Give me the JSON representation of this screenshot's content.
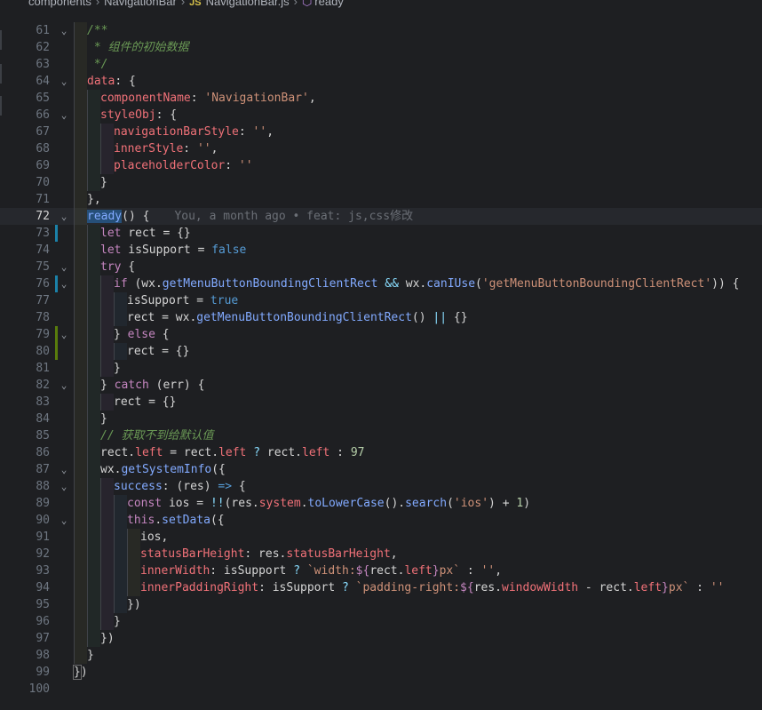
{
  "breadcrumb": {
    "folder": "components",
    "subfolder": "NavigationBar",
    "file_badge": "JS",
    "file": "NavigationBar.js",
    "symbol": "ready"
  },
  "colors": {
    "background": "#1e1f22",
    "keyword": "#c586c0",
    "string": "#ce9178",
    "property": "#f07178",
    "function": "#82aaff",
    "comment": "#6a9955",
    "modified_gutter": "#1b81a8",
    "added_gutter": "#587c0c"
  },
  "blame_line": 72,
  "blame": "You, a month ago • feat: js,css修改",
  "lines": [
    {
      "n": 61,
      "fold": true,
      "indent": 1,
      "tokens": [
        [
          "cm",
          "/**"
        ]
      ]
    },
    {
      "n": 62,
      "indent": 1,
      "tokens": [
        [
          "cm",
          " * 组件的初始数据"
        ]
      ]
    },
    {
      "n": 63,
      "indent": 1,
      "tokens": [
        [
          "cm",
          " */"
        ]
      ]
    },
    {
      "n": 64,
      "fold": true,
      "indent": 1,
      "tokens": [
        [
          "pr",
          "data"
        ],
        [
          "pl",
          ": {"
        ]
      ]
    },
    {
      "n": 65,
      "indent": 2,
      "tokens": [
        [
          "pr",
          "componentName"
        ],
        [
          "pl",
          ": "
        ],
        [
          "st",
          "'NavigationBar'"
        ],
        [
          "pl",
          ","
        ]
      ]
    },
    {
      "n": 66,
      "fold": true,
      "indent": 2,
      "tokens": [
        [
          "pr",
          "styleObj"
        ],
        [
          "pl",
          ": {"
        ]
      ]
    },
    {
      "n": 67,
      "indent": 3,
      "tokens": [
        [
          "pr",
          "navigationBarStyle"
        ],
        [
          "pl",
          ": "
        ],
        [
          "st",
          "''"
        ],
        [
          "pl",
          ","
        ]
      ]
    },
    {
      "n": 68,
      "indent": 3,
      "tokens": [
        [
          "pr",
          "innerStyle"
        ],
        [
          "pl",
          ": "
        ],
        [
          "st",
          "''"
        ],
        [
          "pl",
          ","
        ]
      ]
    },
    {
      "n": 69,
      "indent": 3,
      "tokens": [
        [
          "pr",
          "placeholderColor"
        ],
        [
          "pl",
          ": "
        ],
        [
          "st",
          "''"
        ]
      ]
    },
    {
      "n": 70,
      "indent": 2,
      "tokens": [
        [
          "pl",
          "}"
        ]
      ]
    },
    {
      "n": 71,
      "indent": 1,
      "tokens": [
        [
          "pl",
          "},"
        ]
      ]
    },
    {
      "n": 72,
      "fold": true,
      "current": true,
      "indent": 1,
      "tokens": [
        [
          "hl",
          "ready"
        ],
        [
          "pl",
          "() {"
        ]
      ]
    },
    {
      "n": 73,
      "mark": "mod",
      "indent": 2,
      "tokens": [
        [
          "kw",
          "let"
        ],
        [
          "pl",
          " rect = {}"
        ]
      ]
    },
    {
      "n": 74,
      "indent": 2,
      "tokens": [
        [
          "kw",
          "let"
        ],
        [
          "pl",
          " isSupport = "
        ],
        [
          "bl",
          "false"
        ]
      ]
    },
    {
      "n": 75,
      "fold": true,
      "indent": 2,
      "tokens": [
        [
          "kw",
          "try"
        ],
        [
          "pl",
          " {"
        ]
      ]
    },
    {
      "n": 76,
      "fold": true,
      "mark": "mod",
      "indent": 3,
      "tokens": [
        [
          "kw",
          "if"
        ],
        [
          "pl",
          " (wx."
        ],
        [
          "fn",
          "getMenuButtonBoundingClientRect"
        ],
        [
          "pl",
          " "
        ],
        [
          "op",
          "&&"
        ],
        [
          "pl",
          " wx."
        ],
        [
          "fn",
          "canIUse"
        ],
        [
          "pl",
          "("
        ],
        [
          "st",
          "'getMenuButtonBoundingClientRect'"
        ],
        [
          "pl",
          ")) {"
        ]
      ]
    },
    {
      "n": 77,
      "indent": 4,
      "tokens": [
        [
          "pl",
          "isSupport = "
        ],
        [
          "bl",
          "true"
        ]
      ]
    },
    {
      "n": 78,
      "indent": 4,
      "tokens": [
        [
          "pl",
          "rect = wx."
        ],
        [
          "fn",
          "getMenuButtonBoundingClientRect"
        ],
        [
          "pl",
          "() "
        ],
        [
          "op",
          "||"
        ],
        [
          "pl",
          " {}"
        ]
      ]
    },
    {
      "n": 79,
      "fold": true,
      "mark": "add",
      "indent": 3,
      "tokens": [
        [
          "pl",
          "} "
        ],
        [
          "kw",
          "else"
        ],
        [
          "pl",
          " {"
        ]
      ]
    },
    {
      "n": 80,
      "mark": "add",
      "indent": 4,
      "tokens": [
        [
          "pl",
          "rect = {}"
        ]
      ]
    },
    {
      "n": 81,
      "indent": 3,
      "tokens": [
        [
          "pl",
          "}"
        ]
      ]
    },
    {
      "n": 82,
      "fold": true,
      "indent": 2,
      "tokens": [
        [
          "pl",
          "} "
        ],
        [
          "kw",
          "catch"
        ],
        [
          "pl",
          " (err) {"
        ]
      ]
    },
    {
      "n": 83,
      "indent": 3,
      "tokens": [
        [
          "pl",
          "rect = {}"
        ]
      ]
    },
    {
      "n": 84,
      "indent": 2,
      "tokens": [
        [
          "pl",
          "}"
        ]
      ]
    },
    {
      "n": 85,
      "indent": 2,
      "tokens": [
        [
          "cm",
          "// 获取不到给默认值"
        ]
      ]
    },
    {
      "n": 86,
      "indent": 2,
      "tokens": [
        [
          "pl",
          "rect."
        ],
        [
          "pr",
          "left"
        ],
        [
          "pl",
          " = rect."
        ],
        [
          "pr",
          "left"
        ],
        [
          "pl",
          " "
        ],
        [
          "op",
          "?"
        ],
        [
          "pl",
          " rect."
        ],
        [
          "pr",
          "left"
        ],
        [
          "pl",
          " : "
        ],
        [
          "nm",
          "97"
        ]
      ]
    },
    {
      "n": 87,
      "fold": true,
      "indent": 2,
      "tokens": [
        [
          "pl",
          "wx."
        ],
        [
          "fn",
          "getSystemInfo"
        ],
        [
          "pl",
          "({"
        ]
      ]
    },
    {
      "n": 88,
      "fold": true,
      "indent": 3,
      "tokens": [
        [
          "fn",
          "success"
        ],
        [
          "pl",
          ": (res) "
        ],
        [
          "bl",
          "=>"
        ],
        [
          "pl",
          " {"
        ]
      ]
    },
    {
      "n": 89,
      "indent": 4,
      "tokens": [
        [
          "kw",
          "const"
        ],
        [
          "pl",
          " ios = "
        ],
        [
          "op",
          "!!"
        ],
        [
          "pl",
          "(res."
        ],
        [
          "pr",
          "system"
        ],
        [
          "pl",
          "."
        ],
        [
          "fn",
          "toLowerCase"
        ],
        [
          "pl",
          "()."
        ],
        [
          "fn",
          "search"
        ],
        [
          "pl",
          "("
        ],
        [
          "st",
          "'ios'"
        ],
        [
          "pl",
          ") + "
        ],
        [
          "nm",
          "1"
        ],
        [
          "pl",
          ")"
        ]
      ]
    },
    {
      "n": 90,
      "fold": true,
      "indent": 4,
      "tokens": [
        [
          "kw",
          "this"
        ],
        [
          "pl",
          "."
        ],
        [
          "fn",
          "setData"
        ],
        [
          "pl",
          "({"
        ]
      ]
    },
    {
      "n": 91,
      "indent": 5,
      "tokens": [
        [
          "pl",
          "ios,"
        ]
      ]
    },
    {
      "n": 92,
      "indent": 5,
      "tokens": [
        [
          "pr",
          "statusBarHeight"
        ],
        [
          "pl",
          ": res."
        ],
        [
          "pr",
          "statusBarHeight"
        ],
        [
          "pl",
          ","
        ]
      ]
    },
    {
      "n": 93,
      "indent": 5,
      "tokens": [
        [
          "pr",
          "innerWidth"
        ],
        [
          "pl",
          ": isSupport "
        ],
        [
          "op",
          "?"
        ],
        [
          "pl",
          " "
        ],
        [
          "st",
          "`width:"
        ],
        [
          "kw",
          "${"
        ],
        [
          "pl",
          "rect."
        ],
        [
          "pr",
          "left"
        ],
        [
          "kw",
          "}"
        ],
        [
          "st",
          "px`"
        ],
        [
          "pl",
          " : "
        ],
        [
          "st",
          "''"
        ],
        [
          "pl",
          ","
        ]
      ]
    },
    {
      "n": 94,
      "indent": 5,
      "tokens": [
        [
          "pr",
          "innerPaddingRight"
        ],
        [
          "pl",
          ": isSupport "
        ],
        [
          "op",
          "?"
        ],
        [
          "pl",
          " "
        ],
        [
          "st",
          "`padding-right:"
        ],
        [
          "kw",
          "${"
        ],
        [
          "pl",
          "res."
        ],
        [
          "pr",
          "windowWidth"
        ],
        [
          "pl",
          " - rect."
        ],
        [
          "pr",
          "left"
        ],
        [
          "kw",
          "}"
        ],
        [
          "st",
          "px`"
        ],
        [
          "pl",
          " : "
        ],
        [
          "st",
          "''"
        ]
      ]
    },
    {
      "n": 95,
      "indent": 4,
      "tokens": [
        [
          "pl",
          "})"
        ]
      ]
    },
    {
      "n": 96,
      "indent": 3,
      "tokens": [
        [
          "pl",
          "}"
        ]
      ]
    },
    {
      "n": 97,
      "indent": 2,
      "tokens": [
        [
          "pl",
          "})"
        ]
      ]
    },
    {
      "n": 98,
      "indent": 1,
      "tokens": [
        [
          "pl",
          "}"
        ]
      ]
    },
    {
      "n": 99,
      "indent": 0,
      "tokens": [
        [
          "br",
          "}"
        ],
        [
          "pl",
          ")"
        ]
      ]
    },
    {
      "n": 100,
      "indent": 0,
      "tokens": []
    }
  ]
}
